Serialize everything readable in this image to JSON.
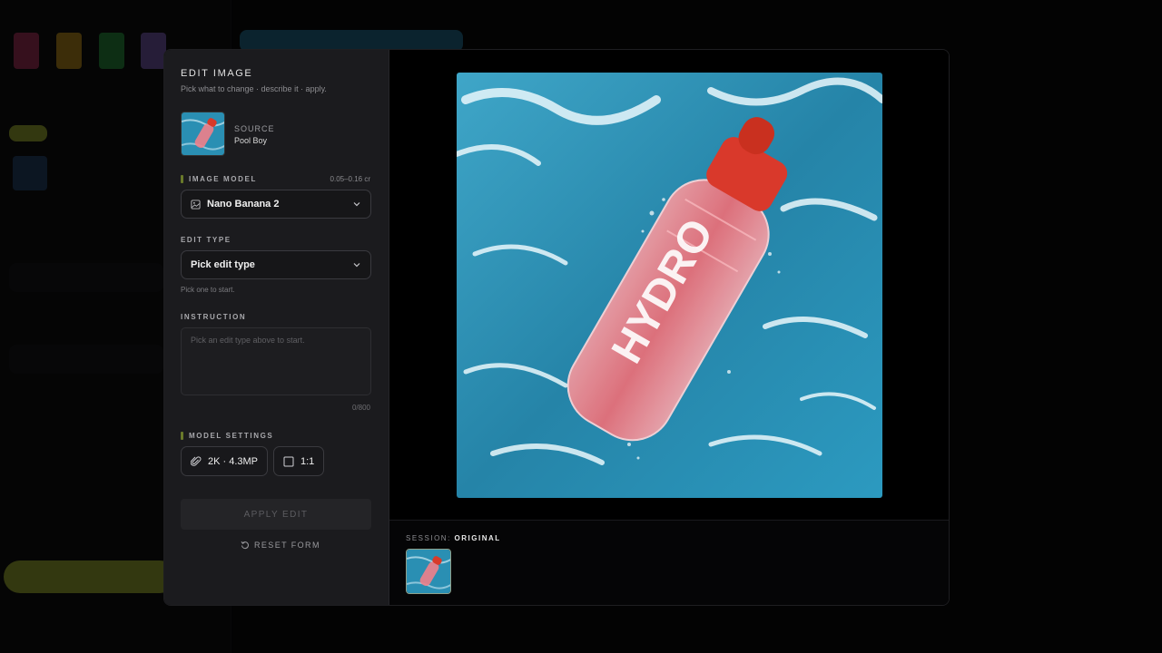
{
  "modal": {
    "title": "EDIT IMAGE",
    "subtitle": "Pick what to change · describe it · apply.",
    "source": {
      "label": "SOURCE",
      "value": "Pool Boy"
    },
    "image_model": {
      "label": "IMAGE MODEL",
      "cost": "0.05–0.16 cr",
      "selected": "Nano Banana 2"
    },
    "edit_type": {
      "label": "EDIT TYPE",
      "selected": "Pick edit type",
      "hint": "Pick one to start."
    },
    "instruction": {
      "label": "INSTRUCTION",
      "placeholder": "Pick an edit type above to start.",
      "counter": "0/800"
    },
    "model_settings": {
      "label": "MODEL SETTINGS",
      "resolution": "2K · 4.3MP",
      "aspect": "1:1"
    },
    "apply_label": "APPLY EDIT",
    "reset_label": "RESET FORM"
  },
  "preview": {
    "bottle_text": "HYDRO",
    "session_label": "SESSION:",
    "session_value": "ORIGINAL"
  },
  "colors": {
    "accent_bar": "#6a7a2a",
    "water": "#2a8fb3",
    "bottle": "#e85a5a",
    "cap": "#d83a2a"
  },
  "icons": {
    "model": "image-icon",
    "chevron": "chevron-down-icon",
    "resolution": "paperclip-icon",
    "aspect": "square-icon",
    "reset": "reset-icon",
    "close": "close-icon"
  }
}
